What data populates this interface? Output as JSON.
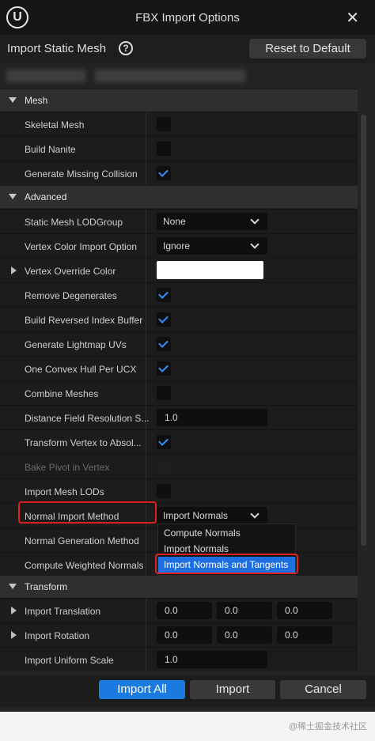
{
  "window": {
    "title": "FBX Import Options",
    "logo": "U"
  },
  "header": {
    "title": "Import Static Mesh",
    "help": "?",
    "reset_label": "Reset to Default"
  },
  "sections": {
    "mesh": "Mesh",
    "advanced": "Advanced",
    "transform": "Transform"
  },
  "mesh": {
    "skeletal_mesh": {
      "label": "Skeletal Mesh",
      "checked": false
    },
    "build_nanite": {
      "label": "Build Nanite",
      "checked": false
    },
    "generate_missing_collision": {
      "label": "Generate Missing Collision",
      "checked": true
    }
  },
  "advanced": {
    "lod_group": {
      "label": "Static Mesh LODGroup",
      "value": "None"
    },
    "vertex_color_import": {
      "label": "Vertex Color Import Option",
      "value": "Ignore"
    },
    "vertex_override_color": {
      "label": "Vertex Override Color",
      "color": "#ffffff"
    },
    "remove_degenerates": {
      "label": "Remove Degenerates",
      "checked": true
    },
    "build_reversed_index": {
      "label": "Build Reversed Index Buffer",
      "checked": true
    },
    "generate_lightmap_uvs": {
      "label": "Generate Lightmap UVs",
      "checked": true
    },
    "one_convex_hull": {
      "label": "One Convex Hull Per UCX",
      "checked": true
    },
    "combine_meshes": {
      "label": "Combine Meshes",
      "checked": false
    },
    "distance_field_scale": {
      "label": "Distance Field Resolution S...",
      "value": "1.0"
    },
    "transform_vertex": {
      "label": "Transform Vertex to Absol...",
      "checked": true
    },
    "bake_pivot": {
      "label": "Bake Pivot in Vertex",
      "checked": false
    },
    "import_mesh_lods": {
      "label": "Import Mesh LODs",
      "checked": false
    },
    "normal_import_method": {
      "label": "Normal Import Method",
      "value": "Import Normals"
    },
    "normal_generation_method": {
      "label": "Normal Generation Method"
    },
    "compute_weighted_normals": {
      "label": "Compute Weighted Normals"
    }
  },
  "normal_options": [
    "Compute Normals",
    "Import Normals",
    "Import Normals and Tangents"
  ],
  "transform": {
    "translation": {
      "label": "Import Translation",
      "values": [
        "0.0",
        "0.0",
        "0.0"
      ]
    },
    "rotation": {
      "label": "Import Rotation",
      "values": [
        "0.0",
        "0.0",
        "0.0"
      ]
    },
    "uniform_scale": {
      "label": "Import Uniform Scale",
      "value": "1.0"
    }
  },
  "footer": {
    "import_all": "Import All",
    "import": "Import",
    "cancel": "Cancel"
  },
  "watermark": "@稀土掘金技术社区",
  "colors": {
    "accent": "#1a7ae0",
    "highlight": "#e0201f",
    "checkmark": "#2f8fff"
  }
}
